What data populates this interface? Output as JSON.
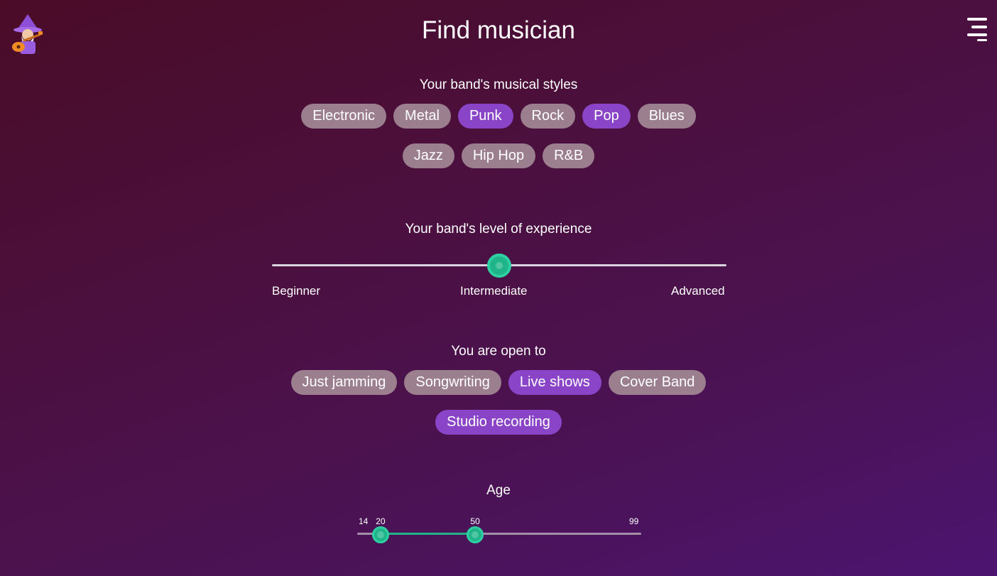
{
  "header": {
    "title": "Find musician",
    "logo_icon": "wizard-guitar-icon",
    "menu_icon": "menu-icon"
  },
  "styles_section": {
    "label": "Your band's musical styles",
    "options": [
      {
        "label": "Electronic",
        "selected": false
      },
      {
        "label": "Metal",
        "selected": false
      },
      {
        "label": "Punk",
        "selected": true
      },
      {
        "label": "Rock",
        "selected": false
      },
      {
        "label": "Pop",
        "selected": true
      },
      {
        "label": "Blues",
        "selected": false
      },
      {
        "label": "Jazz",
        "selected": false
      },
      {
        "label": "Hip Hop",
        "selected": false
      },
      {
        "label": "R&B",
        "selected": false
      }
    ]
  },
  "experience_section": {
    "label": "Your band's level of experience",
    "levels": [
      "Beginner",
      "Intermediate",
      "Advanced"
    ],
    "selected_level": "Intermediate",
    "value_fraction": 0.5
  },
  "open_to_section": {
    "label": "You are open to",
    "options": [
      {
        "label": "Just jamming",
        "selected": false
      },
      {
        "label": "Songwriting",
        "selected": false
      },
      {
        "label": "Live shows",
        "selected": true
      },
      {
        "label": "Cover Band",
        "selected": false
      },
      {
        "label": "Studio recording",
        "selected": true
      }
    ]
  },
  "age_section": {
    "label": "Age",
    "min": "14",
    "max": "99",
    "low": "20",
    "high": "50"
  },
  "colors": {
    "chip_default": "#9b7f8f",
    "chip_selected": "#8a44c8",
    "accent": "#1fb48a"
  }
}
